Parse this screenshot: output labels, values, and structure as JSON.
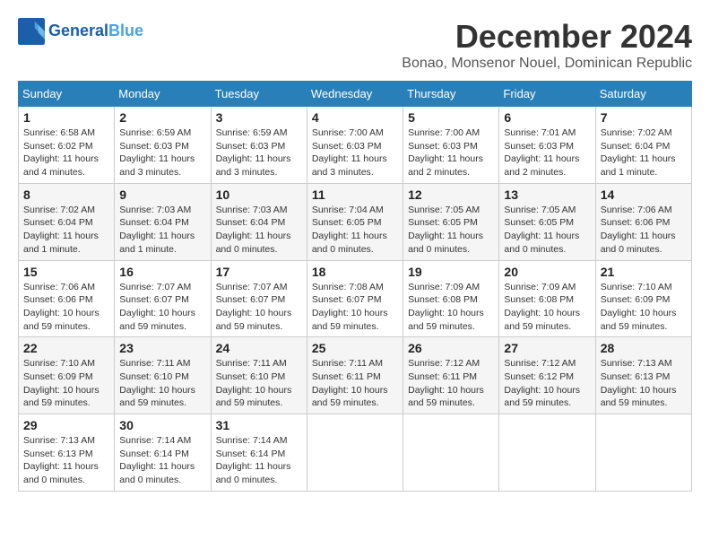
{
  "header": {
    "logo_line1": "General",
    "logo_line2": "Blue",
    "title": "December 2024",
    "location": "Bonao, Monsenor Nouel, Dominican Republic"
  },
  "days_of_week": [
    "Sunday",
    "Monday",
    "Tuesday",
    "Wednesday",
    "Thursday",
    "Friday",
    "Saturday"
  ],
  "weeks": [
    [
      {
        "day": "1",
        "info": "Sunrise: 6:58 AM\nSunset: 6:02 PM\nDaylight: 11 hours and 4 minutes."
      },
      {
        "day": "2",
        "info": "Sunrise: 6:59 AM\nSunset: 6:03 PM\nDaylight: 11 hours and 3 minutes."
      },
      {
        "day": "3",
        "info": "Sunrise: 6:59 AM\nSunset: 6:03 PM\nDaylight: 11 hours and 3 minutes."
      },
      {
        "day": "4",
        "info": "Sunrise: 7:00 AM\nSunset: 6:03 PM\nDaylight: 11 hours and 3 minutes."
      },
      {
        "day": "5",
        "info": "Sunrise: 7:00 AM\nSunset: 6:03 PM\nDaylight: 11 hours and 2 minutes."
      },
      {
        "day": "6",
        "info": "Sunrise: 7:01 AM\nSunset: 6:03 PM\nDaylight: 11 hours and 2 minutes."
      },
      {
        "day": "7",
        "info": "Sunrise: 7:02 AM\nSunset: 6:04 PM\nDaylight: 11 hours and 1 minute."
      }
    ],
    [
      {
        "day": "8",
        "info": "Sunrise: 7:02 AM\nSunset: 6:04 PM\nDaylight: 11 hours and 1 minute."
      },
      {
        "day": "9",
        "info": "Sunrise: 7:03 AM\nSunset: 6:04 PM\nDaylight: 11 hours and 1 minute."
      },
      {
        "day": "10",
        "info": "Sunrise: 7:03 AM\nSunset: 6:04 PM\nDaylight: 11 hours and 0 minutes."
      },
      {
        "day": "11",
        "info": "Sunrise: 7:04 AM\nSunset: 6:05 PM\nDaylight: 11 hours and 0 minutes."
      },
      {
        "day": "12",
        "info": "Sunrise: 7:05 AM\nSunset: 6:05 PM\nDaylight: 11 hours and 0 minutes."
      },
      {
        "day": "13",
        "info": "Sunrise: 7:05 AM\nSunset: 6:05 PM\nDaylight: 11 hours and 0 minutes."
      },
      {
        "day": "14",
        "info": "Sunrise: 7:06 AM\nSunset: 6:06 PM\nDaylight: 11 hours and 0 minutes."
      }
    ],
    [
      {
        "day": "15",
        "info": "Sunrise: 7:06 AM\nSunset: 6:06 PM\nDaylight: 10 hours and 59 minutes."
      },
      {
        "day": "16",
        "info": "Sunrise: 7:07 AM\nSunset: 6:07 PM\nDaylight: 10 hours and 59 minutes."
      },
      {
        "day": "17",
        "info": "Sunrise: 7:07 AM\nSunset: 6:07 PM\nDaylight: 10 hours and 59 minutes."
      },
      {
        "day": "18",
        "info": "Sunrise: 7:08 AM\nSunset: 6:07 PM\nDaylight: 10 hours and 59 minutes."
      },
      {
        "day": "19",
        "info": "Sunrise: 7:09 AM\nSunset: 6:08 PM\nDaylight: 10 hours and 59 minutes."
      },
      {
        "day": "20",
        "info": "Sunrise: 7:09 AM\nSunset: 6:08 PM\nDaylight: 10 hours and 59 minutes."
      },
      {
        "day": "21",
        "info": "Sunrise: 7:10 AM\nSunset: 6:09 PM\nDaylight: 10 hours and 59 minutes."
      }
    ],
    [
      {
        "day": "22",
        "info": "Sunrise: 7:10 AM\nSunset: 6:09 PM\nDaylight: 10 hours and 59 minutes."
      },
      {
        "day": "23",
        "info": "Sunrise: 7:11 AM\nSunset: 6:10 PM\nDaylight: 10 hours and 59 minutes."
      },
      {
        "day": "24",
        "info": "Sunrise: 7:11 AM\nSunset: 6:10 PM\nDaylight: 10 hours and 59 minutes."
      },
      {
        "day": "25",
        "info": "Sunrise: 7:11 AM\nSunset: 6:11 PM\nDaylight: 10 hours and 59 minutes."
      },
      {
        "day": "26",
        "info": "Sunrise: 7:12 AM\nSunset: 6:11 PM\nDaylight: 10 hours and 59 minutes."
      },
      {
        "day": "27",
        "info": "Sunrise: 7:12 AM\nSunset: 6:12 PM\nDaylight: 10 hours and 59 minutes."
      },
      {
        "day": "28",
        "info": "Sunrise: 7:13 AM\nSunset: 6:13 PM\nDaylight: 10 hours and 59 minutes."
      }
    ],
    [
      {
        "day": "29",
        "info": "Sunrise: 7:13 AM\nSunset: 6:13 PM\nDaylight: 11 hours and 0 minutes."
      },
      {
        "day": "30",
        "info": "Sunrise: 7:14 AM\nSunset: 6:14 PM\nDaylight: 11 hours and 0 minutes."
      },
      {
        "day": "31",
        "info": "Sunrise: 7:14 AM\nSunset: 6:14 PM\nDaylight: 11 hours and 0 minutes."
      },
      {
        "day": "",
        "info": ""
      },
      {
        "day": "",
        "info": ""
      },
      {
        "day": "",
        "info": ""
      },
      {
        "day": "",
        "info": ""
      }
    ]
  ]
}
